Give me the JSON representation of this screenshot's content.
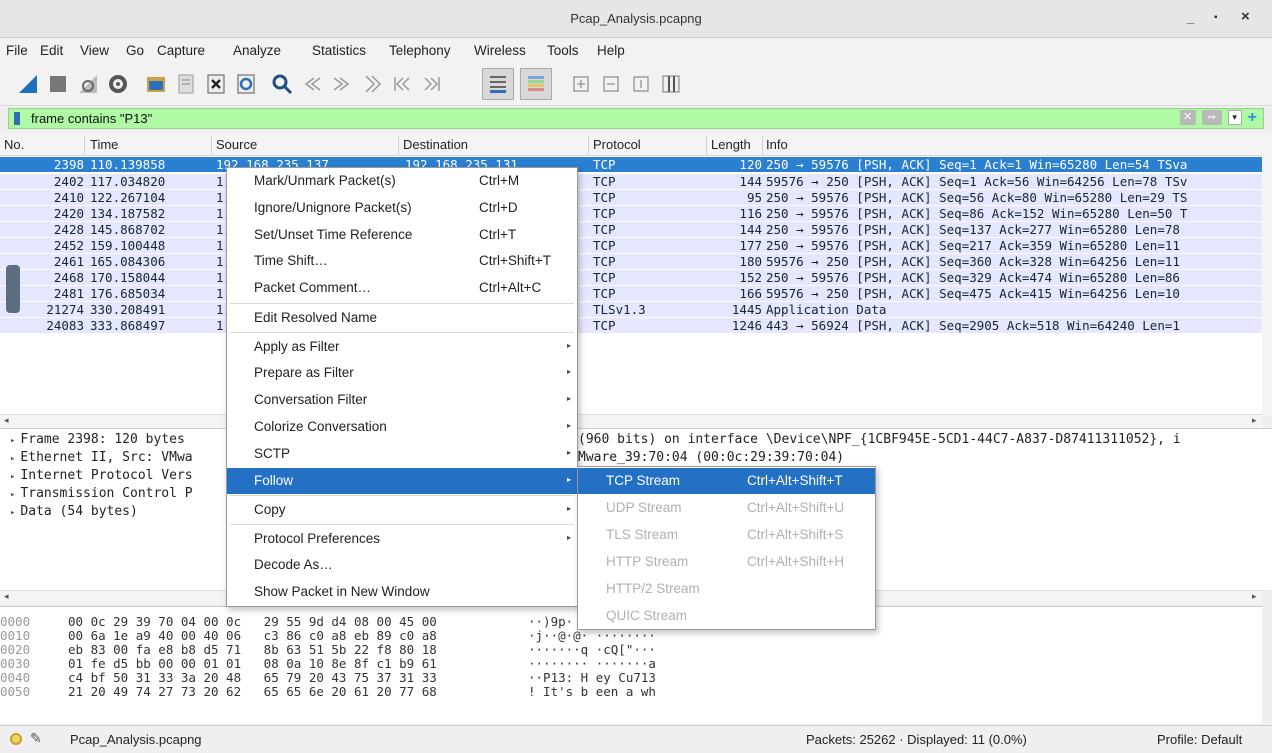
{
  "window": {
    "title": "Pcap_Analysis.pcapng",
    "minimize": "_",
    "maximize": "▪",
    "close": "×"
  },
  "menu": [
    "File",
    "Edit",
    "View",
    "Go",
    "Capture",
    "Analyze",
    "Statistics",
    "Telephony",
    "Wireless",
    "Tools",
    "Help"
  ],
  "filter": {
    "value": "frame contains \"P13\"",
    "clear_glyph": "✕",
    "apply_glyph": "⇒",
    "dropdown_glyph": "▾",
    "add_glyph": "+"
  },
  "columns": [
    "No.",
    "Time",
    "Source",
    "Destination",
    "Protocol",
    "Length",
    "Info"
  ],
  "packets": [
    {
      "no": "2398",
      "time": "110.139858",
      "src": "192.168.235.137",
      "dst": "192.168.235.131",
      "proto": "TCP",
      "len": "120",
      "info": "250 → 59576 [PSH, ACK] Seq=1 Ack=1 Win=65280 Len=54 TSva"
    },
    {
      "no": "2402",
      "time": "117.034820",
      "src": "1",
      "dst": "",
      "proto": "TCP",
      "len": "144",
      "info": "59576 → 250 [PSH, ACK] Seq=1 Ack=56 Win=64256 Len=78 TSv"
    },
    {
      "no": "2410",
      "time": "122.267104",
      "src": "1",
      "dst": "",
      "proto": "TCP",
      "len": "95",
      "info": "250 → 59576 [PSH, ACK] Seq=56 Ack=80 Win=65280 Len=29 TS"
    },
    {
      "no": "2420",
      "time": "134.187582",
      "src": "1",
      "dst": "",
      "proto": "TCP",
      "len": "116",
      "info": "250 → 59576 [PSH, ACK] Seq=86 Ack=152 Win=65280 Len=50 T"
    },
    {
      "no": "2428",
      "time": "145.868702",
      "src": "1",
      "dst": "",
      "proto": "TCP",
      "len": "144",
      "info": "250 → 59576 [PSH, ACK] Seq=137 Ack=277 Win=65280 Len=78"
    },
    {
      "no": "2452",
      "time": "159.100448",
      "src": "1",
      "dst": "",
      "proto": "TCP",
      "len": "177",
      "info": "250 → 59576 [PSH, ACK] Seq=217 Ack=359 Win=65280 Len=11"
    },
    {
      "no": "2461",
      "time": "165.084306",
      "src": "1",
      "dst": "",
      "proto": "TCP",
      "len": "180",
      "info": "59576 → 250 [PSH, ACK] Seq=360 Ack=328 Win=64256 Len=11"
    },
    {
      "no": "2468",
      "time": "170.158044",
      "src": "1",
      "dst": "",
      "proto": "TCP",
      "len": "152",
      "info": "250 → 59576 [PSH, ACK] Seq=329 Ack=474 Win=65280 Len=86"
    },
    {
      "no": "2481",
      "time": "176.685034",
      "src": "1",
      "dst": "",
      "proto": "TCP",
      "len": "166",
      "info": "59576 → 250 [PSH, ACK] Seq=475 Ack=415 Win=64256 Len=10"
    },
    {
      "no": "21274",
      "time": "330.208491",
      "src": "1",
      "dst": "",
      "proto": "TLSv1.3",
      "len": "1445",
      "info": "Application Data"
    },
    {
      "no": "24083",
      "time": "333.868497",
      "src": "1",
      "dst": "",
      "proto": "TCP",
      "len": "1246",
      "info": "443 → 56924 [PSH, ACK] Seq=2905 Ack=518 Win=64240 Len=1"
    }
  ],
  "details": [
    {
      "left": "Frame 2398: 120 bytes",
      "right": "(960 bits) on interface \\Device\\NPF_{1CBF945E-5CD1-44C7-A837-D87411311052}, i"
    },
    {
      "left": "Ethernet II, Src: VMwa",
      "right": "Mware_39:70:04 (00:0c:29:39:70:04)"
    },
    {
      "left": "Internet Protocol Vers",
      "right": ""
    },
    {
      "left": "Transmission Control P",
      "right": ""
    },
    {
      "left": "Data (54 bytes)",
      "right": ""
    }
  ],
  "hexdump": [
    {
      "off": "0000",
      "bytes": "00 0c 29 39 70 04 00 0c   29 55 9d d4 08 00 45 00",
      "ascii": "··)9p·"
    },
    {
      "off": "0010",
      "bytes": "00 6a 1e a9 40 00 40 06   c3 86 c0 a8 eb 89 c0 a8",
      "ascii": "·j··@·@· ········"
    },
    {
      "off": "0020",
      "bytes": "eb 83 00 fa e8 b8 d5 71   8b 63 51 5b 22 f8 80 18",
      "ascii": "·······q ·cQ[\"···"
    },
    {
      "off": "0030",
      "bytes": "01 fe d5 bb 00 00 01 01   08 0a 10 8e 8f c1 b9 61",
      "ascii": "········ ·······a"
    },
    {
      "off": "0040",
      "bytes": "c4 bf 50 31 33 3a 20 48   65 79 20 43 75 37 31 33",
      "ascii": "··P13: H ey Cu713"
    },
    {
      "off": "0050",
      "bytes": "21 20 49 74 27 73 20 62   65 65 6e 20 61 20 77 68",
      "ascii": "! It's b een a wh"
    }
  ],
  "context_menu": [
    {
      "label": "Mark/Unmark Packet(s)",
      "shortcut": "Ctrl+M"
    },
    {
      "label": "Ignore/Unignore Packet(s)",
      "shortcut": "Ctrl+D"
    },
    {
      "label": "Set/Unset Time Reference",
      "shortcut": "Ctrl+T"
    },
    {
      "label": "Time Shift…",
      "shortcut": "Ctrl+Shift+T"
    },
    {
      "label": "Packet Comment…",
      "shortcut": "Ctrl+Alt+C"
    },
    {
      "label": "Edit Resolved Name",
      "shortcut": ""
    },
    {
      "label": "Apply as Filter",
      "shortcut": ""
    },
    {
      "label": "Prepare as Filter",
      "shortcut": ""
    },
    {
      "label": "Conversation Filter",
      "shortcut": ""
    },
    {
      "label": "Colorize Conversation",
      "shortcut": ""
    },
    {
      "label": "SCTP",
      "shortcut": ""
    },
    {
      "label": "Follow",
      "shortcut": ""
    },
    {
      "label": "Copy",
      "shortcut": ""
    },
    {
      "label": "Protocol Preferences",
      "shortcut": ""
    },
    {
      "label": "Decode As…",
      "shortcut": ""
    },
    {
      "label": "Show Packet in New Window",
      "shortcut": ""
    }
  ],
  "submenu_arrow": "▸",
  "follow_submenu": [
    {
      "label": "TCP Stream",
      "shortcut": "Ctrl+Alt+Shift+T"
    },
    {
      "label": "UDP Stream",
      "shortcut": "Ctrl+Alt+Shift+U"
    },
    {
      "label": "TLS Stream",
      "shortcut": "Ctrl+Alt+Shift+S"
    },
    {
      "label": "HTTP Stream",
      "shortcut": "Ctrl+Alt+Shift+H"
    },
    {
      "label": "HTTP/2 Stream",
      "shortcut": ""
    },
    {
      "label": "QUIC Stream",
      "shortcut": ""
    }
  ],
  "status": {
    "file": "Pcap_Analysis.pcapng",
    "packets": "Packets: 25262 · Displayed: 11 (0.0%)",
    "profile": "Profile: Default"
  },
  "colors": {
    "selected_row": "#2b7fd1",
    "tcp_row": "#e7e6ff",
    "filter_ok": "#aff8a4",
    "menu_highlight": "#2470c4"
  }
}
